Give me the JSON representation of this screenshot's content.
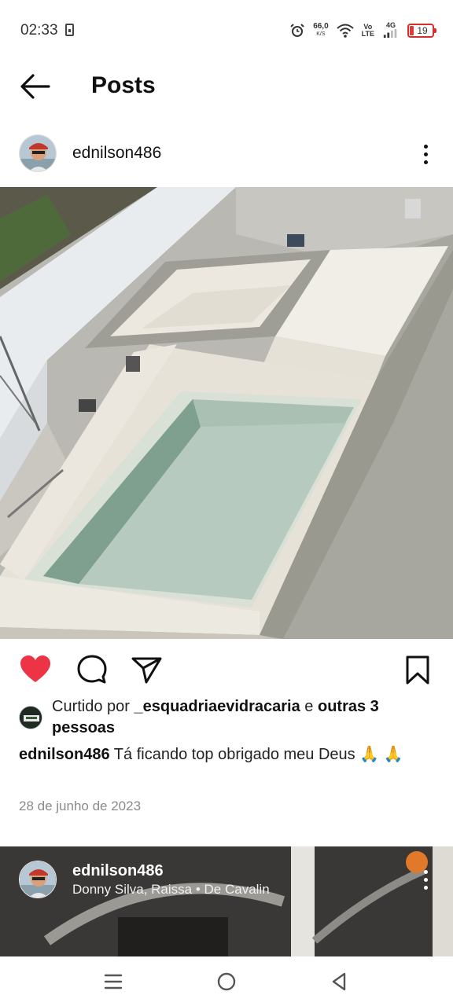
{
  "status_bar": {
    "time": "02:33",
    "net_speed": "66,0",
    "net_speed_unit": "K/S",
    "volte_top": "Vo",
    "volte_bottom": "LTE",
    "network_type": "4G",
    "battery": "19",
    "battery_color": "#d32f2f"
  },
  "header": {
    "title": "Posts"
  },
  "post": {
    "username": "ednilson486",
    "liked_by_prefix": "Curtido por ",
    "liked_by_user": "_esquadriaevidracaria",
    "liked_by_middle": " e ",
    "liked_by_others": "outras 3 pessoas",
    "caption_user": "ednilson486",
    "caption_text": " Tá ficando top obrigado meu Deus 🙏 🙏",
    "date": "28 de junho de 2023",
    "like_color": "#ed3346"
  },
  "next_post": {
    "username": "ednilson486",
    "subtitle": "Donny Silva, Raissa • De Cavalin"
  },
  "icons": {
    "back": "arrow-left-icon",
    "more": "more-vertical-icon",
    "like": "heart-filled-icon",
    "comment": "comment-bubble-icon",
    "share": "send-paper-plane-icon",
    "save": "bookmark-icon",
    "nav_menu": "menu-lines-icon",
    "nav_home": "circle-home-icon",
    "nav_back": "triangle-back-icon"
  }
}
